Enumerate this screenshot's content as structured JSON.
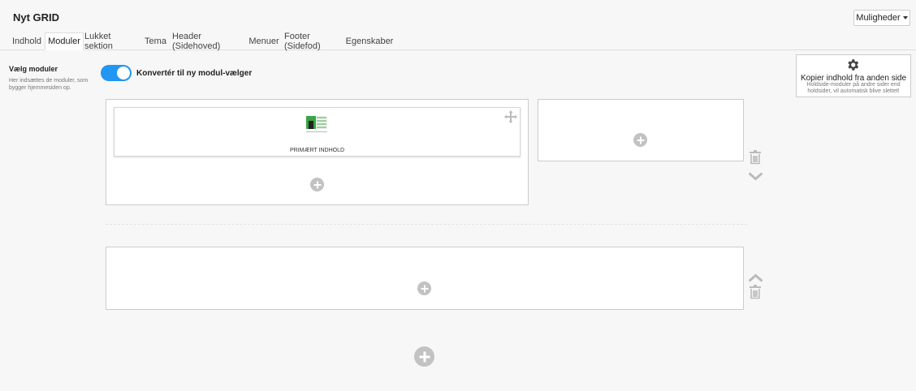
{
  "header": {
    "title": "Nyt GRID",
    "options_label": "Muligheder"
  },
  "tabs": [
    {
      "label": "Indhold",
      "active": false
    },
    {
      "label": "Moduler",
      "active": true
    },
    {
      "label": "Lukket sektion",
      "active": false
    },
    {
      "label": "Tema",
      "active": false
    },
    {
      "label": "Header (Sidehoved)",
      "active": false
    },
    {
      "label": "Menuer",
      "active": false
    },
    {
      "label": "Footer (Sidefod)",
      "active": false
    },
    {
      "label": "Egenskaber",
      "active": false
    }
  ],
  "sidebar": {
    "heading": "Vælg moduler",
    "description": "Her indsættes de moduler, som bygger hjemmesiden op."
  },
  "toggle": {
    "label": "Konvertér til ny modul-vælger",
    "on": true
  },
  "copy_box": {
    "title": "Kopier indhold fra anden side",
    "description": "Holdside-moduler på andre sider end holdsider, vil automatisk blive slettet!"
  },
  "grid": {
    "module": {
      "label": "PRIMÆRT INDHOLD"
    }
  },
  "colors": {
    "accent": "#2196f3",
    "icon_gray": "#c2c2c2",
    "module_green": "#3aa545"
  },
  "icons": [
    "gear-icon",
    "move-icon",
    "add-icon",
    "trash-icon",
    "chevron-down-icon",
    "chevron-up-icon",
    "module-thumbnail-icon"
  ]
}
